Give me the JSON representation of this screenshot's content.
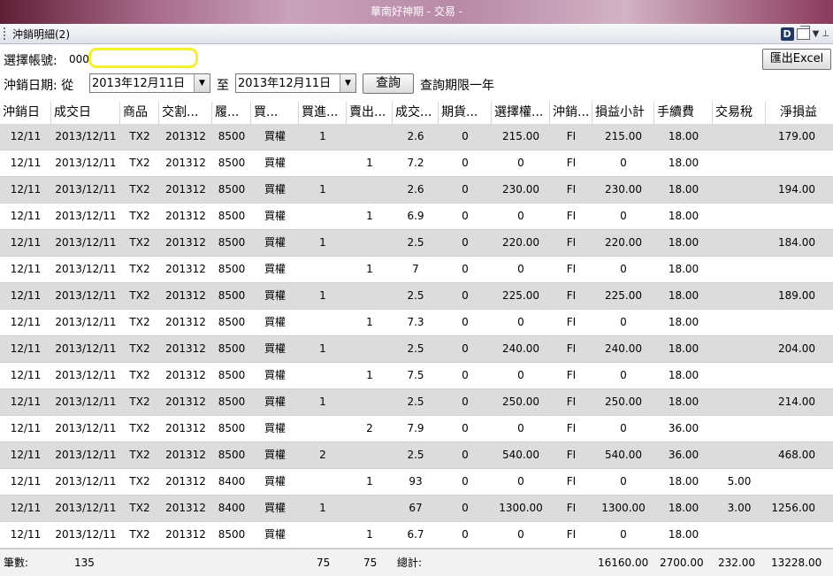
{
  "window": {
    "title": "華南好神期 - 交易 -"
  },
  "panel": {
    "title": "沖銷明細(2)",
    "badge": "D",
    "dropdown_glyph": "▼",
    "pin_glyph": "⊥"
  },
  "form": {
    "account_label": "選擇帳號:",
    "account_value": "000",
    "date_label": "沖銷日期: 從",
    "date_from": "2013年12月11日",
    "to_label": "至",
    "date_to": "2013年12月11日",
    "query_button": "查詢",
    "query_limit": "查詢期限一年",
    "export_button": "匯出Excel"
  },
  "table": {
    "columns": [
      "沖銷日",
      "成交日",
      "商品",
      "交割...",
      "履...",
      "買...",
      "買進...",
      "賣出...",
      "成交...",
      "期貨...",
      "選擇權...",
      "沖銷...",
      "損益小計",
      "手續費",
      "交易稅",
      "淨損益"
    ],
    "rows": [
      [
        "12/11",
        "2013/12/11",
        "TX2",
        "201312",
        "8500",
        "買權",
        "1",
        "",
        "2.6",
        "0",
        "215.00",
        "FI",
        "215.00",
        "18.00",
        "",
        "179.00"
      ],
      [
        "12/11",
        "2013/12/11",
        "TX2",
        "201312",
        "8500",
        "買權",
        "",
        "1",
        "7.2",
        "0",
        "0",
        "FI",
        "0",
        "18.00",
        "",
        ""
      ],
      [
        "12/11",
        "2013/12/11",
        "TX2",
        "201312",
        "8500",
        "買權",
        "1",
        "",
        "2.6",
        "0",
        "230.00",
        "FI",
        "230.00",
        "18.00",
        "",
        "194.00"
      ],
      [
        "12/11",
        "2013/12/11",
        "TX2",
        "201312",
        "8500",
        "買權",
        "",
        "1",
        "6.9",
        "0",
        "0",
        "FI",
        "0",
        "18.00",
        "",
        ""
      ],
      [
        "12/11",
        "2013/12/11",
        "TX2",
        "201312",
        "8500",
        "買權",
        "1",
        "",
        "2.5",
        "0",
        "220.00",
        "FI",
        "220.00",
        "18.00",
        "",
        "184.00"
      ],
      [
        "12/11",
        "2013/12/11",
        "TX2",
        "201312",
        "8500",
        "買權",
        "",
        "1",
        "7",
        "0",
        "0",
        "FI",
        "0",
        "18.00",
        "",
        ""
      ],
      [
        "12/11",
        "2013/12/11",
        "TX2",
        "201312",
        "8500",
        "買權",
        "1",
        "",
        "2.5",
        "0",
        "225.00",
        "FI",
        "225.00",
        "18.00",
        "",
        "189.00"
      ],
      [
        "12/11",
        "2013/12/11",
        "TX2",
        "201312",
        "8500",
        "買權",
        "",
        "1",
        "7.3",
        "0",
        "0",
        "FI",
        "0",
        "18.00",
        "",
        ""
      ],
      [
        "12/11",
        "2013/12/11",
        "TX2",
        "201312",
        "8500",
        "買權",
        "1",
        "",
        "2.5",
        "0",
        "240.00",
        "FI",
        "240.00",
        "18.00",
        "",
        "204.00"
      ],
      [
        "12/11",
        "2013/12/11",
        "TX2",
        "201312",
        "8500",
        "買權",
        "",
        "1",
        "7.5",
        "0",
        "0",
        "FI",
        "0",
        "18.00",
        "",
        ""
      ],
      [
        "12/11",
        "2013/12/11",
        "TX2",
        "201312",
        "8500",
        "買權",
        "1",
        "",
        "2.5",
        "0",
        "250.00",
        "FI",
        "250.00",
        "18.00",
        "",
        "214.00"
      ],
      [
        "12/11",
        "2013/12/11",
        "TX2",
        "201312",
        "8500",
        "買權",
        "",
        "2",
        "7.9",
        "0",
        "0",
        "FI",
        "0",
        "36.00",
        "",
        ""
      ],
      [
        "12/11",
        "2013/12/11",
        "TX2",
        "201312",
        "8500",
        "買權",
        "2",
        "",
        "2.5",
        "0",
        "540.00",
        "FI",
        "540.00",
        "36.00",
        "",
        "468.00"
      ],
      [
        "12/11",
        "2013/12/11",
        "TX2",
        "201312",
        "8400",
        "買權",
        "",
        "1",
        "93",
        "0",
        "0",
        "FI",
        "0",
        "18.00",
        "5.00",
        ""
      ],
      [
        "12/11",
        "2013/12/11",
        "TX2",
        "201312",
        "8400",
        "買權",
        "1",
        "",
        "67",
        "0",
        "1300.00",
        "FI",
        "1300.00",
        "18.00",
        "3.00",
        "1256.00"
      ],
      [
        "12/11",
        "2013/12/11",
        "TX2",
        "201312",
        "8500",
        "買權",
        "",
        "1",
        "6.7",
        "0",
        "0",
        "FI",
        "0",
        "18.00",
        "",
        ""
      ]
    ]
  },
  "footer": {
    "count_label": "筆數:",
    "count_value": "135",
    "buy_total": "75",
    "sell_total": "75",
    "total_label": "總計:",
    "pnl_total": "16160.00",
    "fee_total": "2700.00",
    "tax_total": "232.00",
    "net_total": "13228.00"
  },
  "colors": {
    "row_alt": "#dcdcdc",
    "highlight_mask": "#f6ef2e"
  }
}
